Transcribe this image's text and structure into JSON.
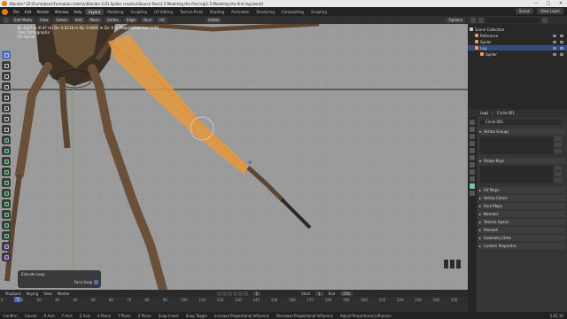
{
  "titlebar": {
    "text": "Blender* [D:\\Formations\\Formation Udemy\\Blender 2.81 Spider creation\\Source files\\1.5-Modeling the first leg\\1.5-Modeling the first leg.blend]",
    "minimize": "—",
    "maximize": "□",
    "close": "✕"
  },
  "menu": {
    "items": [
      "File",
      "Edit",
      "Render",
      "Window",
      "Help"
    ],
    "workspaces": [
      "Layout",
      "Modeling",
      "Sculpting",
      "UV Editing",
      "Texture Paint",
      "Shading",
      "Animation",
      "Rendering",
      "Compositing",
      "Scripting"
    ],
    "scene": "Scene",
    "view_layer": "View Layer"
  },
  "viewport_header": {
    "mode": "Edit Mode",
    "view": "View",
    "select": "Select",
    "add": "Add",
    "mesh": "Mesh",
    "vertex": "Vertex",
    "edge": "Edge",
    "face": "Face",
    "uv": "UV",
    "transform": "Global",
    "options": "Options"
  },
  "overlay": {
    "line1": "D: -0.07 m (0.07 m)  Dx: 0.0116 m  Dy: 0.0691 m  Dz: 0 m  Proportional size: 0.61",
    "line2": "User Orthographic",
    "line3": "(0) Spider"
  },
  "redo_panel": {
    "title": "Extrude Loop",
    "label": "Face Snap"
  },
  "timeline": {
    "playback": "Playback",
    "keying": "Keying",
    "view": "View",
    "marker": "Marker",
    "current_frame": "1",
    "start_label": "Start",
    "start": "1",
    "end_label": "End",
    "end": "250",
    "ticks": [
      "0",
      "10",
      "20",
      "30",
      "40",
      "50",
      "60",
      "70",
      "80",
      "90",
      "100",
      "110",
      "120",
      "130",
      "140",
      "150",
      "160",
      "170",
      "180",
      "190",
      "200",
      "210",
      "220",
      "230",
      "240",
      "250"
    ]
  },
  "statusbar": {
    "items": [
      "Confirm",
      "Cancel",
      "X Axis",
      "Y Axis",
      "Z Axis",
      "X Plane",
      "Y Plane",
      "Z Plane",
      "Snap Invert",
      "Snap Toggle",
      "Increase Proportional Influence",
      "Decrease Proportional Influence",
      "Adjust Proportional Influence"
    ],
    "version": "2.81.16"
  },
  "outliner": {
    "rows": [
      {
        "label": "Scene Collection",
        "color": "#cccccc"
      },
      {
        "label": "Reference",
        "color": "#e0a060"
      },
      {
        "label": "Spider",
        "color": "#e0a060"
      },
      {
        "label": "Leg",
        "color": "#f2a14a"
      },
      {
        "label": "Spider",
        "color": "#f2a14a"
      }
    ]
  },
  "properties": {
    "object_name": "Legs",
    "data_name": "Circle.001",
    "mesh_field": "Circle.001",
    "panels": [
      {
        "label": "Vertex Groups",
        "open": true
      },
      {
        "label": "Shape Keys",
        "open": true
      },
      {
        "label": "UV Maps",
        "open": false
      },
      {
        "label": "Vertex Colors",
        "open": false
      },
      {
        "label": "Face Maps",
        "open": false
      },
      {
        "label": "Normals",
        "open": false
      },
      {
        "label": "Texture Space",
        "open": false
      },
      {
        "label": "Remesh",
        "open": false
      },
      {
        "label": "Geometry Data",
        "open": false
      },
      {
        "label": "Custom Properties",
        "open": false
      }
    ]
  },
  "colors": {
    "selection_orange": "#f08a24",
    "viewport_bg": "#9b9b9b",
    "active_blue": "#4772b3"
  }
}
